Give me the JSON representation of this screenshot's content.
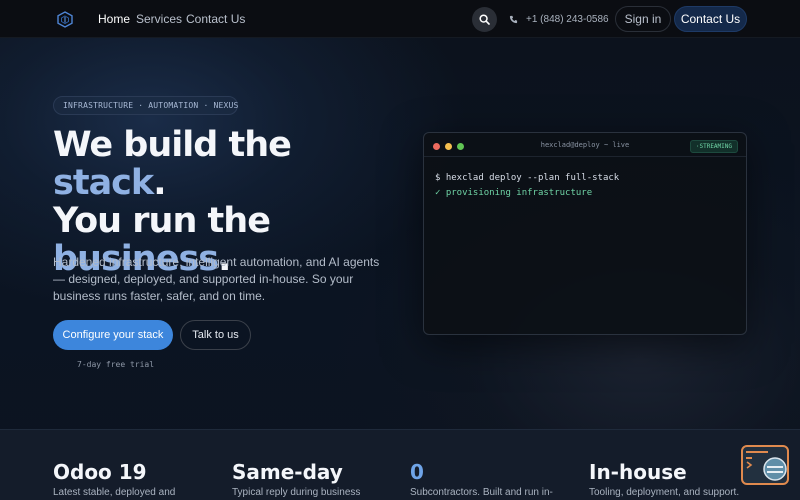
{
  "nav": {
    "links": [
      "Home",
      "Services",
      "Contact Us"
    ],
    "phone": "+1 (848) 243-0586",
    "signin": "Sign in",
    "contact": "Contact Us"
  },
  "hero": {
    "badge": "INFRASTRUCTURE · AUTOMATION · NEXUS",
    "headline": {
      "part1": "We build the ",
      "highlight1": "stack",
      "part2": ".",
      "part3": "You run the",
      "highlight2": "business",
      "part4": "."
    },
    "subtext": "Hardened infrastructure, intelligent automation, and AI agents — designed, deployed, and supported in-house. So your business runs faster, safer, and on time.",
    "primary_cta": "Configure your stack",
    "secondary_cta": "Talk to us",
    "trial_note": "7-day free trial"
  },
  "terminal": {
    "title": "hexclad@deploy ~ live",
    "status": "·STREAMING",
    "lines": [
      "$ hexclad deploy --plan full-stack",
      "✓ provisioning infrastructure"
    ]
  },
  "stats": [
    {
      "value": "Odoo 19",
      "desc": "Latest stable, deployed and"
    },
    {
      "value": "Same-day",
      "desc": "Typical reply during business"
    },
    {
      "value": "0",
      "desc": "Subcontractors. Built and run in-"
    },
    {
      "value": "In-house",
      "desc": "Tooling, deployment, and support."
    }
  ],
  "colors": {
    "accent": "#3d86dc",
    "highlight": "#8fb1e3",
    "terminal_green": "#6fd3a5",
    "chat_border": "#e08a4e"
  },
  "icons": {
    "logo": "hexagon-logo-icon",
    "search": "search-icon",
    "phone": "phone-icon",
    "chat": "chat-widget-icon"
  }
}
